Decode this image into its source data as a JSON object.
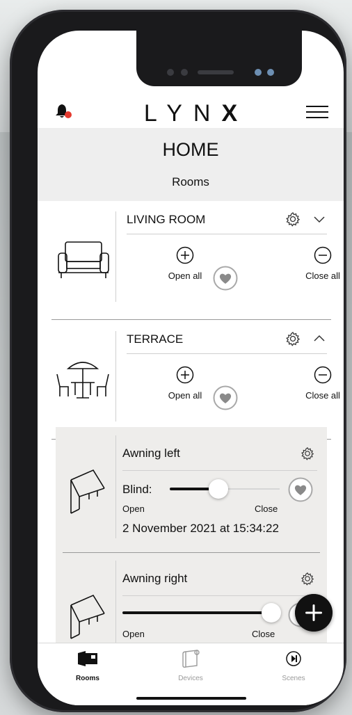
{
  "app": {
    "logo_light": "LYN",
    "logo_bold": "X"
  },
  "header": {
    "title": "HOME",
    "subtitle": "Rooms"
  },
  "rooms": [
    {
      "name": "LIVING ROOM",
      "open_label": "Open all",
      "close_label": "Close all",
      "expanded": false
    },
    {
      "name": "TERRACE",
      "open_label": "Open all",
      "close_label": "Close all",
      "expanded": true
    }
  ],
  "devices": [
    {
      "name": "Awning left",
      "type_label": "Blind:",
      "open_label": "Open",
      "close_label": "Close",
      "position_fraction": 0.44,
      "timestamp": "2 November 2021 at 15:34:22"
    },
    {
      "name": "Awning right",
      "open_label": "Open",
      "close_label": "Close",
      "position_fraction": 1.0
    }
  ],
  "tabbar": {
    "tabs": [
      {
        "label": "Rooms",
        "active": true
      },
      {
        "label": "Devices",
        "active": false
      },
      {
        "label": "Scenes",
        "active": false
      }
    ]
  },
  "colors": {
    "accent": "#111111",
    "notification": "#e53a2f",
    "band": "#eeeeee",
    "panel": "#eeedeb",
    "inactive": "#9a9a9a"
  },
  "icons": [
    "bell-icon",
    "menu-icon",
    "sofa-icon",
    "patio-icon",
    "gear-icon",
    "chevron-down-icon",
    "chevron-up-icon",
    "plus-circle-icon",
    "minus-circle-icon",
    "heart-icon",
    "awning-icon",
    "rooms-icon",
    "devices-icon",
    "scenes-icon",
    "plus-icon"
  ]
}
